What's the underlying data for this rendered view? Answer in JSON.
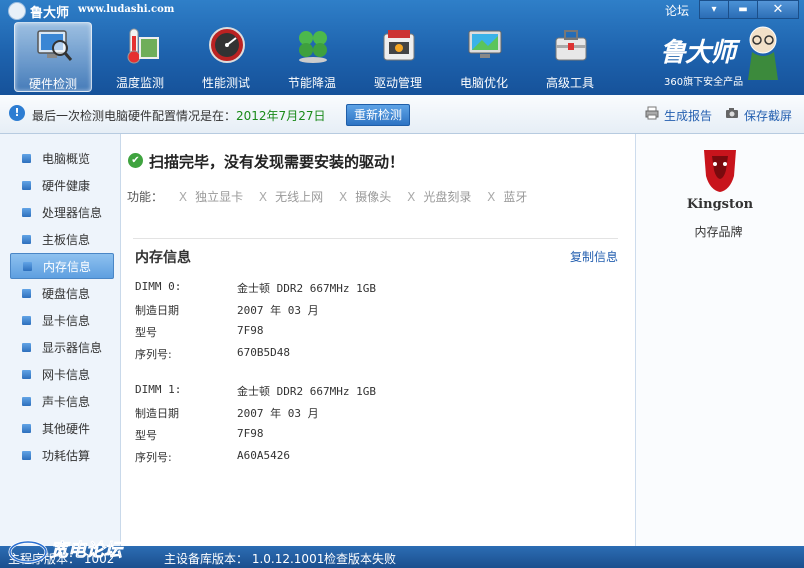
{
  "titlebar": {
    "app_title": "鲁大师",
    "app_url": "www.ludashi.com",
    "forum_link": "论坛",
    "btn_menu": "▾",
    "btn_minimize": "▬",
    "btn_close": "✕"
  },
  "nav": [
    {
      "label": "硬件检测",
      "icon": "monitor-magnifier-icon",
      "active": true
    },
    {
      "label": "温度监测",
      "icon": "thermometer-icon",
      "active": false
    },
    {
      "label": "性能测试",
      "icon": "speedometer-icon",
      "active": false
    },
    {
      "label": "节能降温",
      "icon": "clover-leaf-icon",
      "active": false
    },
    {
      "label": "驱动管理",
      "icon": "driver-box-icon",
      "active": false
    },
    {
      "label": "电脑优化",
      "icon": "optimize-screen-icon",
      "active": false
    },
    {
      "label": "高级工具",
      "icon": "toolbox-icon",
      "active": false
    }
  ],
  "brand": {
    "name": "鲁大师",
    "sub": "360旗下安全产品"
  },
  "infobar": {
    "text": "最后一次检测电脑硬件配置情况是在：",
    "date": "2012年7月27日",
    "recheck_button": "重新检测",
    "report_link": "生成报告",
    "screenshot_link": "保存截屏"
  },
  "sidebar": [
    {
      "label": "电脑概览",
      "active": false
    },
    {
      "label": "硬件健康",
      "active": false
    },
    {
      "label": "处理器信息",
      "active": false
    },
    {
      "label": "主板信息",
      "active": false
    },
    {
      "label": "内存信息",
      "active": true
    },
    {
      "label": "硬盘信息",
      "active": false
    },
    {
      "label": "显卡信息",
      "active": false
    },
    {
      "label": "显示器信息",
      "active": false
    },
    {
      "label": "网卡信息",
      "active": false
    },
    {
      "label": "声卡信息",
      "active": false
    },
    {
      "label": "其他硬件",
      "active": false
    },
    {
      "label": "功耗估算",
      "active": false
    }
  ],
  "main": {
    "scan_title": "扫描完毕，没有发现需要安装的驱动！",
    "features_label": "功能：",
    "features": [
      "独立显卡",
      "无线上网",
      "摄像头",
      "光盘刻录",
      "蓝牙"
    ],
    "feature_mark": "X",
    "section_title": "内存信息",
    "copy_link": "复制信息",
    "modules": [
      {
        "slot_label": "DIMM 0:",
        "slot_value": "金士顿 DDR2 667MHz 1GB",
        "date_label": "制造日期",
        "date_value": "2007 年 03 月",
        "model_label": "型号",
        "model_value": "7F98",
        "serial_label": "序列号:",
        "serial_value": "670B5D48"
      },
      {
        "slot_label": "DIMM 1:",
        "slot_value": "金士顿 DDR2 667MHz 1GB",
        "date_label": "制造日期",
        "date_value": "2007 年 03 月",
        "model_label": "型号",
        "model_value": "7F98",
        "serial_label": "序列号:",
        "serial_value": "A60A5426"
      }
    ]
  },
  "right_panel": {
    "logo_text": "Kingston",
    "brand_label": "内存品牌"
  },
  "statusbar": {
    "program_version": "主程序版本：",
    "program_version_tail": "1002",
    "db_version": "主设备库版本： 1.0.12.1001",
    "update_status": "检查版本失败"
  },
  "watermark": {
    "text": "宽电论坛"
  },
  "colors": {
    "header_blue": "#1e63ae",
    "accent_green": "#1a8a1a",
    "link_blue": "#2560b0",
    "kingston_red": "#c8141c"
  }
}
